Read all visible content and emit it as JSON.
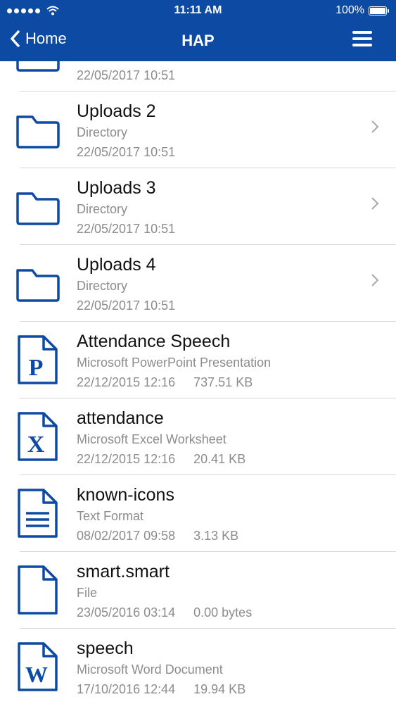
{
  "status_bar": {
    "time": "11:11 AM",
    "battery": "100%"
  },
  "nav": {
    "back_label": "Home",
    "title": "HAP"
  },
  "partial_item": {
    "date": "22/05/2017 10:51"
  },
  "items": [
    {
      "name": "Uploads 2",
      "type": "Directory",
      "date": "22/05/2017 10:51",
      "size": "",
      "icon": "folder-icon"
    },
    {
      "name": "Uploads 3",
      "type": "Directory",
      "date": "22/05/2017 10:51",
      "size": "",
      "icon": "folder-icon"
    },
    {
      "name": "Uploads 4",
      "type": "Directory",
      "date": "22/05/2017 10:51",
      "size": "",
      "icon": "folder-icon"
    },
    {
      "name": "Attendance Speech",
      "type": "Microsoft PowerPoint Presentation",
      "date": "22/12/2015 12:16",
      "size": "737.51 KB",
      "icon": "powerpoint-file-icon",
      "letter": "P"
    },
    {
      "name": "attendance",
      "type": "Microsoft Excel Worksheet",
      "date": "22/12/2015 12:16",
      "size": "20.41 KB",
      "icon": "excel-file-icon",
      "letter": "X"
    },
    {
      "name": "known-icons",
      "type": "Text Format",
      "date": "08/02/2017 09:58",
      "size": "3.13 KB",
      "icon": "text-file-icon"
    },
    {
      "name": "smart.smart",
      "type": "File",
      "date": "23/05/2016 03:14",
      "size": "0.00 bytes",
      "icon": "file-icon"
    },
    {
      "name": "speech",
      "type": "Microsoft Word Document",
      "date": "17/10/2016 12:44",
      "size": "19.94 KB",
      "icon": "word-file-icon",
      "letter": "W"
    }
  ],
  "colors": {
    "accent": "#0d4aa3",
    "secondary_text": "#8c8c8c"
  }
}
